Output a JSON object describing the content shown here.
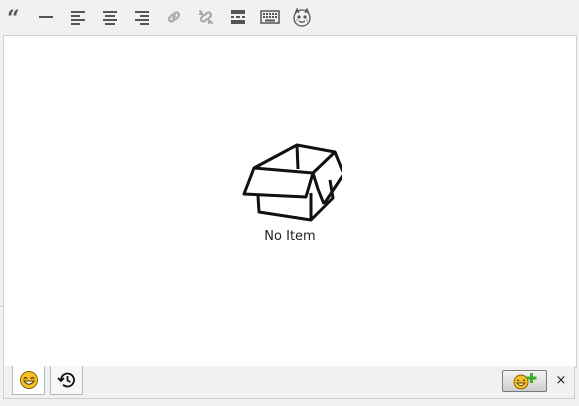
{
  "toolbar": {
    "buttons": [
      {
        "name": "blockquote-icon"
      },
      {
        "name": "horizontal-rule-icon"
      },
      {
        "name": "align-left-icon"
      },
      {
        "name": "align-center-icon"
      },
      {
        "name": "align-right-icon"
      },
      {
        "name": "insert-link-icon"
      },
      {
        "name": "remove-link-icon"
      },
      {
        "name": "read-more-icon"
      },
      {
        "name": "keyboard-toolbar-icon"
      },
      {
        "name": "emoticon-mascot-icon"
      }
    ]
  },
  "panel": {
    "empty_icon": "open-box-icon",
    "empty_text": "No Item"
  },
  "bottom_bar": {
    "tabs": [
      {
        "icon": "smiley-icon",
        "active": true
      },
      {
        "icon": "history-icon",
        "active": false
      }
    ],
    "add_icon": "add-smiley-icon",
    "close_label": "×"
  },
  "colors": {
    "toolbar_icon": "#555555",
    "toolbar_icon_disabled": "#aaaaaa",
    "smiley_fill": "#f5c02a",
    "add_plus": "#3fae2a"
  }
}
